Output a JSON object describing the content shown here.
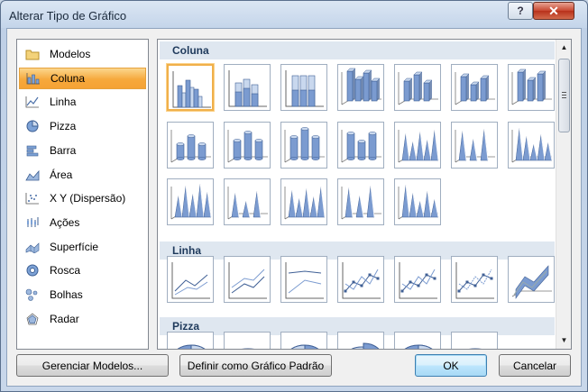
{
  "window": {
    "title": "Alterar Tipo de Gráfico"
  },
  "titlebar": {
    "help_label": "?",
    "close_label": "✕"
  },
  "categories": [
    {
      "label": "Modelos",
      "icon": "folder-icon",
      "selected": false
    },
    {
      "label": "Coluna",
      "icon": "column-chart-icon",
      "selected": true
    },
    {
      "label": "Linha",
      "icon": "line-chart-icon",
      "selected": false
    },
    {
      "label": "Pizza",
      "icon": "pie-chart-icon",
      "selected": false
    },
    {
      "label": "Barra",
      "icon": "bar-chart-icon",
      "selected": false
    },
    {
      "label": "Área",
      "icon": "area-chart-icon",
      "selected": false
    },
    {
      "label": "X Y (Dispersão)",
      "icon": "scatter-chart-icon",
      "selected": false
    },
    {
      "label": "Ações",
      "icon": "stock-chart-icon",
      "selected": false
    },
    {
      "label": "Superfície",
      "icon": "surface-chart-icon",
      "selected": false
    },
    {
      "label": "Rosca",
      "icon": "doughnut-chart-icon",
      "selected": false
    },
    {
      "label": "Bolhas",
      "icon": "bubble-chart-icon",
      "selected": false
    },
    {
      "label": "Radar",
      "icon": "radar-chart-icon",
      "selected": false
    }
  ],
  "sections": {
    "coluna": "Coluna",
    "linha": "Linha",
    "pizza": "Pizza"
  },
  "buttons": {
    "manage_templates": "Gerenciar Modelos...",
    "set_default": "Definir como Gráfico Padrão",
    "ok": "OK",
    "cancel": "Cancelar"
  },
  "colors": {
    "selection": "#f6a93c",
    "section_header_bg": "#dfe7f0",
    "chart_blue": "#6f8fc4"
  }
}
